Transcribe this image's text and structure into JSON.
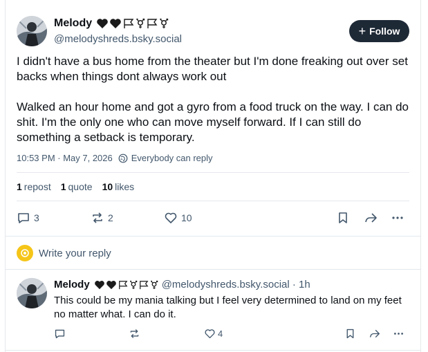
{
  "post": {
    "author": {
      "display_name": "Melody",
      "handle": "@melodyshreds.bsky.social",
      "badges": [
        "black-heart-icon",
        "black-heart-icon",
        "white-flag-icon",
        "transgender-symbol-icon",
        "white-flag-icon",
        "transgender-symbol-icon"
      ]
    },
    "follow_label": "Follow",
    "text": "I didn't have a bus home from the theater but I'm done freaking out over set backs when things dont always work out\n\nWalked an hour home and got a gyro from a food truck on the way. I can do shit. I'm the only one who can move myself forward. If I can still do something a setback is temporary.",
    "timestamp": "10:53 PM · May 7, 2026",
    "audience": "Everybody can reply",
    "stats": {
      "reposts_count": "1",
      "reposts_label": "repost",
      "quotes_count": "1",
      "quotes_label": "quote",
      "likes_count": "10",
      "likes_label": "likes"
    },
    "actions": {
      "replies": "3",
      "reposts": "2",
      "likes": "10"
    }
  },
  "reply_box": {
    "placeholder": "Write your reply"
  },
  "reply": {
    "author": {
      "display_name": "Melody",
      "handle_time": "@melodyshreds.bsky.social · 1h"
    },
    "text": "This could be my mania talking but I feel very determined to land on my feet no matter what. I can do it.",
    "actions": {
      "likes": "4"
    }
  }
}
